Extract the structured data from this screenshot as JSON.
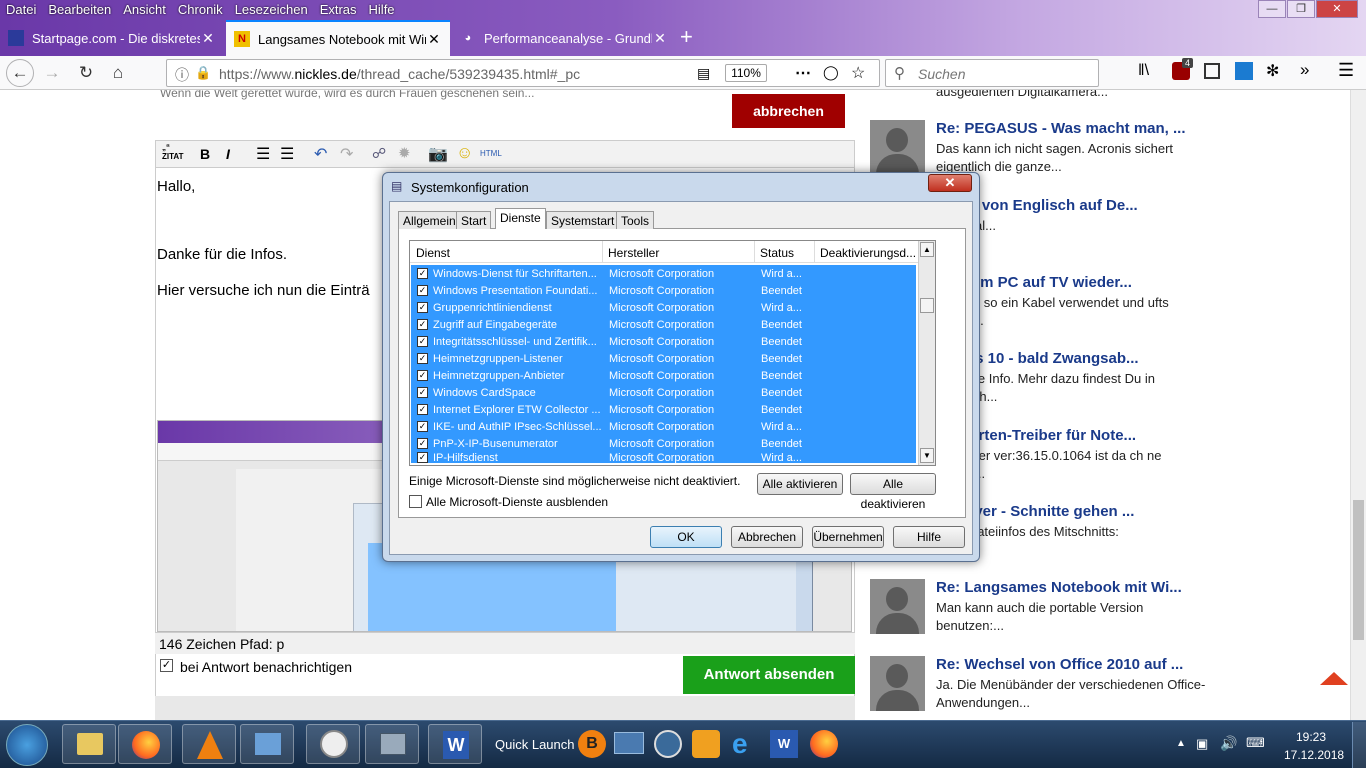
{
  "menu": [
    "Datei",
    "Bearbeiten",
    "Ansicht",
    "Chronik",
    "Lesezeichen",
    "Extras",
    "Hilfe"
  ],
  "tabs": [
    {
      "title": "Startpage.com - Die diskreteste",
      "icon": "startpage-icon"
    },
    {
      "title": "Langsames Notebook mit Windo",
      "icon": "nickles-icon"
    },
    {
      "title": "Performanceanalyse - Grundlag",
      "icon": "performance-icon"
    }
  ],
  "url": {
    "prefix": "https://www.",
    "domain": "nickles.de",
    "path": "/thread_cache/539239435.html#_pc"
  },
  "zoom": "110%",
  "search_placeholder": "Suchen",
  "notification_count": "4",
  "page": {
    "top_text": "Wenn die Welt gerettet würde, wird es durch Frauen geschehen sein...",
    "cancel_button": "abbrechen",
    "zitat": "ZITAT",
    "html_label": "HTML",
    "editor_lines": [
      "Hallo,",
      "Danke für die Infos.",
      "Hier versuche ich nun die Einträ"
    ],
    "status_line": "146 Zeichen Pfad: p",
    "notify_label": "bei Antwort benachrichtigen",
    "submit_button": "Antwort absenden"
  },
  "sidebar": [
    {
      "title": "",
      "text": "ausgedienten Digitalkamera..."
    },
    {
      "title": "Re: PEGASUS - Was macht man, ...",
      "text": "Das kann ich nicht sagen. Acronis sichert eigentlich die ganze..."
    },
    {
      "title": "statur von Englisch auf De...",
      "text": "e es mal..."
    },
    {
      "title": "tos vom PC auf TV wieder...",
      "text": "h hat er so ein Kabel verwendet und ufts sowas..."
    },
    {
      "title": "ndows 10 - bald Zwangsab...",
      "text": "ür Deine Info. Mehr dazu findest Du in Postfach..."
    },
    {
      "title": "afikkarten-Treiber für Note...",
      "text": "GA driver ver:36.15.0.1064 ist da ch ne Option..."
    },
    {
      "title": "C-Player - Schnitte gehen ...",
      "text": "h die Dateiinfos des Mitschnitts:"
    },
    {
      "title": "Re: Langsames Notebook mit Wi...",
      "text": "Man kann auch die portable Version benutzen:..."
    },
    {
      "title": "Re: Wechsel von Office 2010 auf ...",
      "text": "Ja. Die Menübänder der verschiedenen Office-Anwendungen..."
    }
  ],
  "dialog": {
    "title": "Systemkonfiguration",
    "tabs": [
      "Allgemein",
      "Start",
      "Dienste",
      "Systemstart",
      "Tools"
    ],
    "active_tab": "Dienste",
    "columns": [
      "Dienst",
      "Hersteller",
      "Status",
      "Deaktivierungsd..."
    ],
    "rows": [
      {
        "name": "Windows-Dienst für Schriftarten...",
        "vendor": "Microsoft Corporation",
        "status": "Wird a..."
      },
      {
        "name": "Windows Presentation Foundati...",
        "vendor": "Microsoft Corporation",
        "status": "Beendet"
      },
      {
        "name": "Gruppenrichtliniendienst",
        "vendor": "Microsoft Corporation",
        "status": "Wird a..."
      },
      {
        "name": "Zugriff auf Eingabegeräte",
        "vendor": "Microsoft Corporation",
        "status": "Beendet"
      },
      {
        "name": "Integritätsschlüssel- und Zertifik...",
        "vendor": "Microsoft Corporation",
        "status": "Beendet"
      },
      {
        "name": "Heimnetzgruppen-Listener",
        "vendor": "Microsoft Corporation",
        "status": "Beendet"
      },
      {
        "name": "Heimnetzgruppen-Anbieter",
        "vendor": "Microsoft Corporation",
        "status": "Beendet"
      },
      {
        "name": "Windows CardSpace",
        "vendor": "Microsoft Corporation",
        "status": "Beendet"
      },
      {
        "name": "Internet Explorer ETW Collector ...",
        "vendor": "Microsoft Corporation",
        "status": "Beendet"
      },
      {
        "name": "IKE- und AuthIP IPsec-Schlüssel...",
        "vendor": "Microsoft Corporation",
        "status": "Wird a..."
      },
      {
        "name": "PnP-X-IP-Busenumerator",
        "vendor": "Microsoft Corporation",
        "status": "Beendet"
      },
      {
        "name": "IP-Hilfsdienst",
        "vendor": "Microsoft Corporation",
        "status": "Wird a..."
      }
    ],
    "note": "Einige Microsoft-Dienste sind möglicherweise nicht deaktiviert.",
    "enable_all": "Alle aktivieren",
    "disable_all": "Alle deaktivieren",
    "hide_ms": "Alle Microsoft-Dienste ausblenden",
    "ok": "OK",
    "cancel": "Abbrechen",
    "apply": "Übernehmen",
    "help": "Hilfe"
  },
  "taskbar": {
    "quick_launch": "Quick Launch",
    "time": "19:23",
    "date": "17.12.2018"
  },
  "colors": {
    "accent": "#0a84ff",
    "cancel_red": "#a00000",
    "submit_green": "#1aa01a",
    "selection": "#3399ff",
    "link": "#1a3a8a"
  }
}
